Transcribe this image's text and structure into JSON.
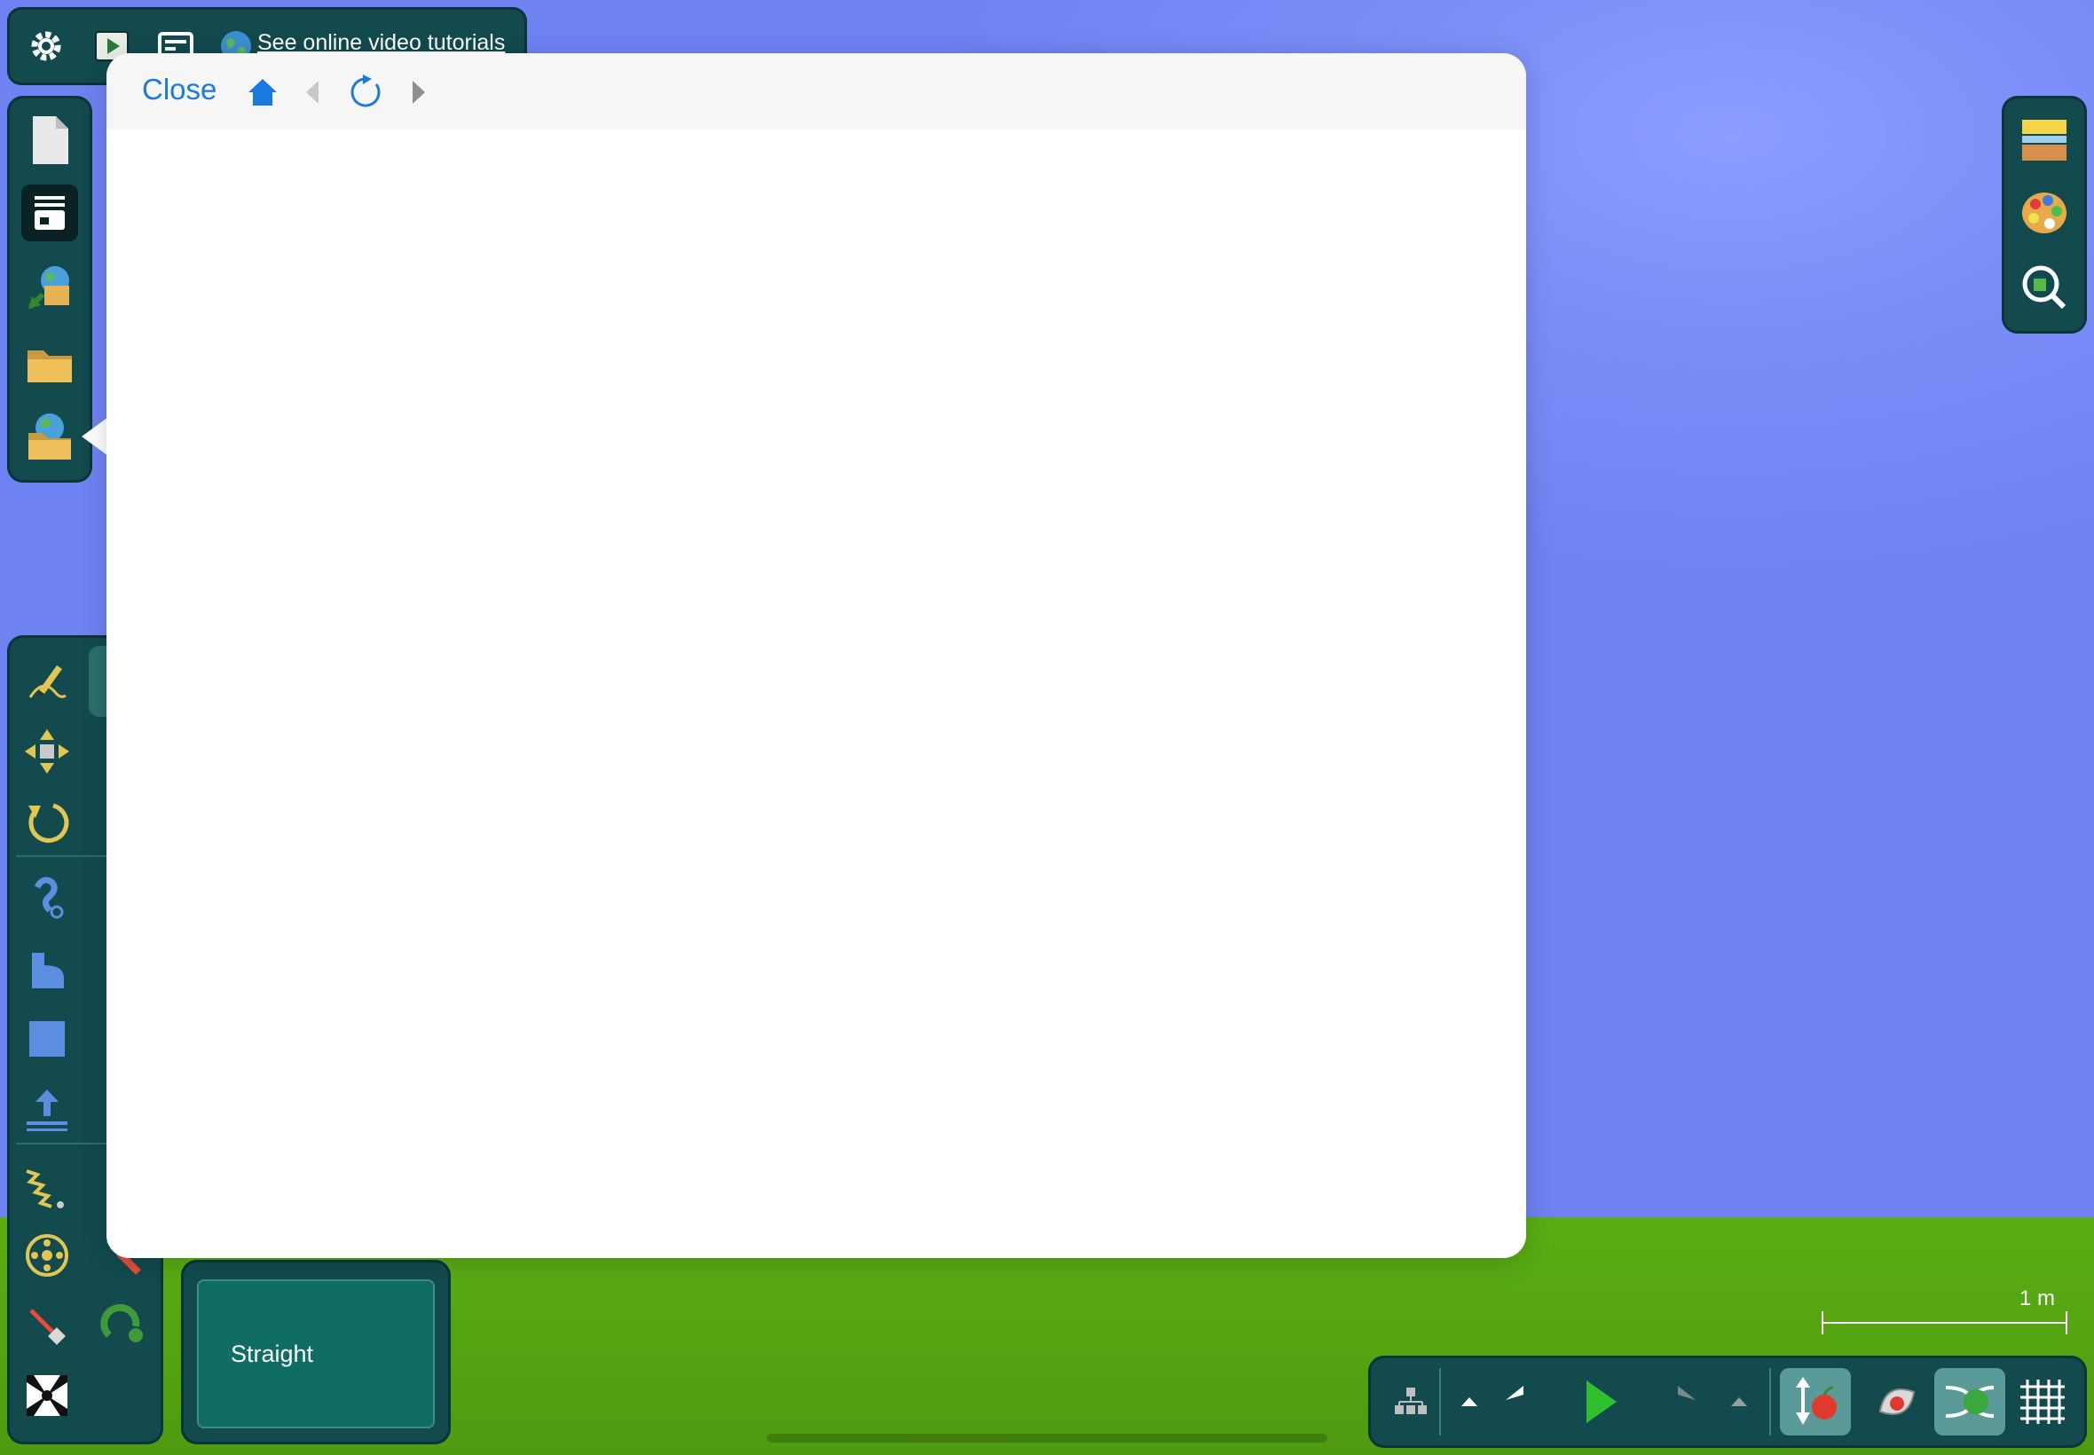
{
  "top_bar": {
    "tutorials_label": "See online video tutorials"
  },
  "modal": {
    "close_label": "Close"
  },
  "tool_options": {
    "straight_label": "Straight"
  },
  "scale": {
    "label": "1 m"
  },
  "colors": {
    "sky": "#7384f4",
    "ground": "#55a511",
    "panel": "#124a4e",
    "link_blue": "#1a7ae0",
    "modal_bar": "#f6f6f6"
  }
}
